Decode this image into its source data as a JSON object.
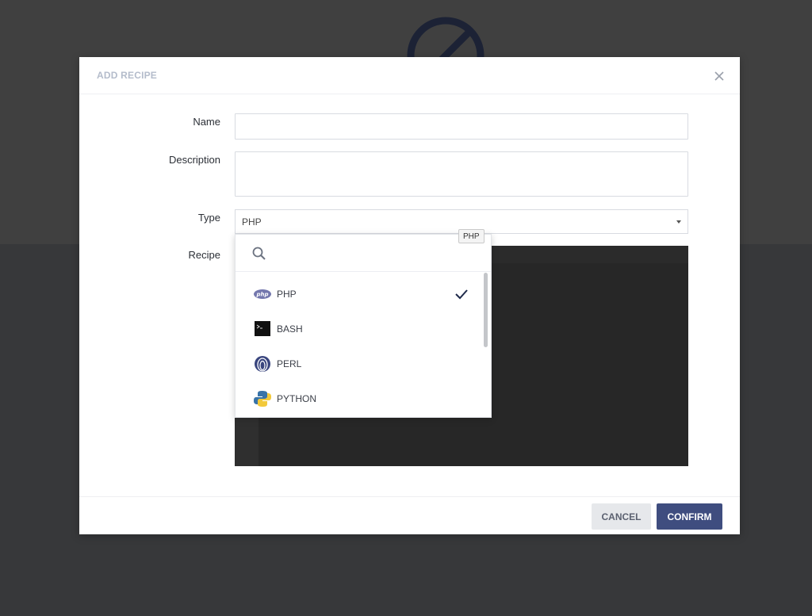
{
  "modal": {
    "title": "ADD RECIPE",
    "close_icon": "close-icon"
  },
  "form": {
    "name_label": "Name",
    "name_value": "",
    "description_label": "Description",
    "description_value": "",
    "type_label": "Type",
    "type_value": "PHP",
    "recipe_label": "Recipe"
  },
  "dropdown": {
    "search_icon": "search-icon",
    "search_placeholder": "",
    "items": [
      {
        "label": "PHP",
        "icon": "php-icon",
        "selected": true
      },
      {
        "label": "BASH",
        "icon": "terminal-icon",
        "selected": false
      },
      {
        "label": "PERL",
        "icon": "perl-onion-icon",
        "selected": false
      },
      {
        "label": "PYTHON",
        "icon": "python-icon",
        "selected": false
      }
    ]
  },
  "tooltip": {
    "text": "PHP"
  },
  "footer": {
    "cancel_label": "CANCEL",
    "confirm_label": "CONFIRM"
  },
  "colors": {
    "confirm_bg": "#3f4d7f",
    "cancel_bg": "#e6e8eb",
    "editor_bg": "#272727",
    "title_color": "#b4bccb"
  }
}
